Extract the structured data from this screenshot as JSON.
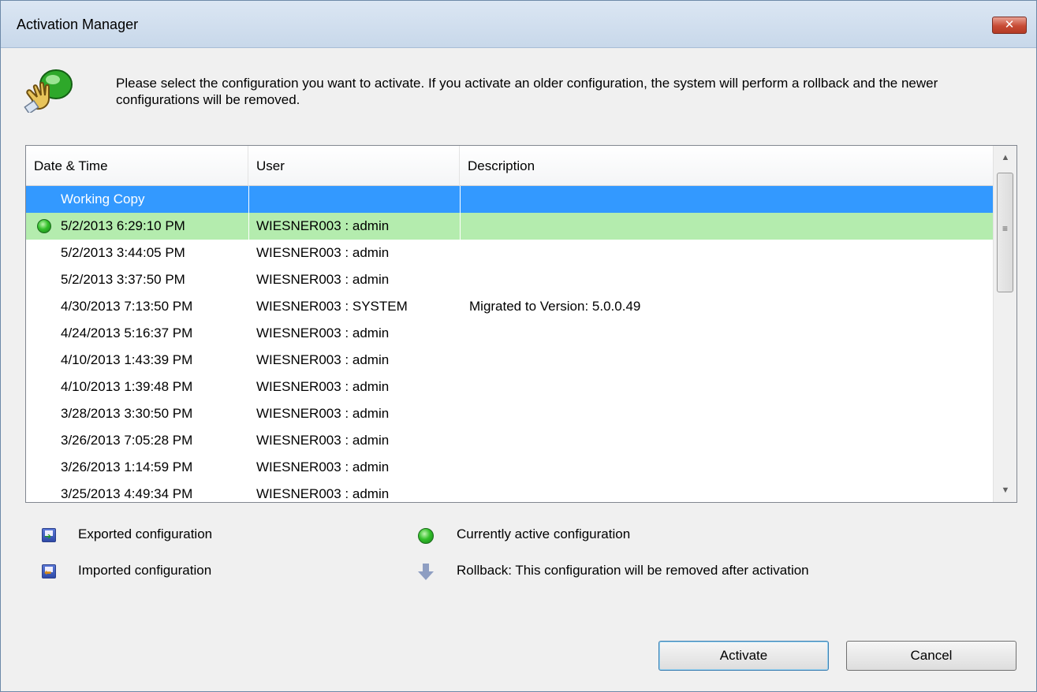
{
  "window": {
    "title": "Activation Manager",
    "close_label": "✕"
  },
  "info": {
    "text": "Please select the configuration you want to activate. If you activate an older configuration, the system will perform a rollback and the newer configurations will be removed."
  },
  "grid": {
    "columns": [
      "Date & Time",
      "User",
      "Description"
    ],
    "rows": [
      {
        "date": "Working Copy",
        "user": "",
        "description": "",
        "state": "selected"
      },
      {
        "date": "5/2/2013 6:29:10 PM",
        "user": "WIESNER003 : admin",
        "description": "",
        "state": "active"
      },
      {
        "date": "5/2/2013 3:44:05 PM",
        "user": "WIESNER003 : admin",
        "description": "",
        "state": "normal"
      },
      {
        "date": "5/2/2013 3:37:50 PM",
        "user": "WIESNER003 : admin",
        "description": "",
        "state": "normal"
      },
      {
        "date": "4/30/2013 7:13:50 PM",
        "user": "WIESNER003 : SYSTEM",
        "description": "Migrated to Version: 5.0.0.49",
        "state": "normal"
      },
      {
        "date": "4/24/2013 5:16:37 PM",
        "user": "WIESNER003 : admin",
        "description": "",
        "state": "normal"
      },
      {
        "date": "4/10/2013 1:43:39 PM",
        "user": "WIESNER003 : admin",
        "description": "",
        "state": "normal"
      },
      {
        "date": "4/10/2013 1:39:48 PM",
        "user": "WIESNER003 : admin",
        "description": "",
        "state": "normal"
      },
      {
        "date": "3/28/2013 3:30:50 PM",
        "user": "WIESNER003 : admin",
        "description": "",
        "state": "normal"
      },
      {
        "date": "3/26/2013 7:05:28 PM",
        "user": "WIESNER003 : admin",
        "description": "",
        "state": "normal"
      },
      {
        "date": "3/26/2013 1:14:59 PM",
        "user": "WIESNER003 : admin",
        "description": "",
        "state": "normal"
      },
      {
        "date": "3/25/2013 4:49:34 PM",
        "user": "WIESNER003 : admin",
        "description": "",
        "state": "normal"
      }
    ]
  },
  "legend": {
    "exported": "Exported configuration",
    "imported": "Imported configuration",
    "active": "Currently active configuration",
    "rollback": "Rollback: This configuration will be removed after activation"
  },
  "buttons": {
    "activate": "Activate",
    "cancel": "Cancel"
  },
  "colors": {
    "selected_row": "#3399ff",
    "active_row": "#b4ecae",
    "active_dot": "#33c02a"
  },
  "icons": {
    "header": "pointing-hand-green-button-icon",
    "exported": "floppy-export-icon",
    "imported": "floppy-import-icon",
    "active": "green-dot-icon",
    "rollback": "down-arrow-icon"
  }
}
